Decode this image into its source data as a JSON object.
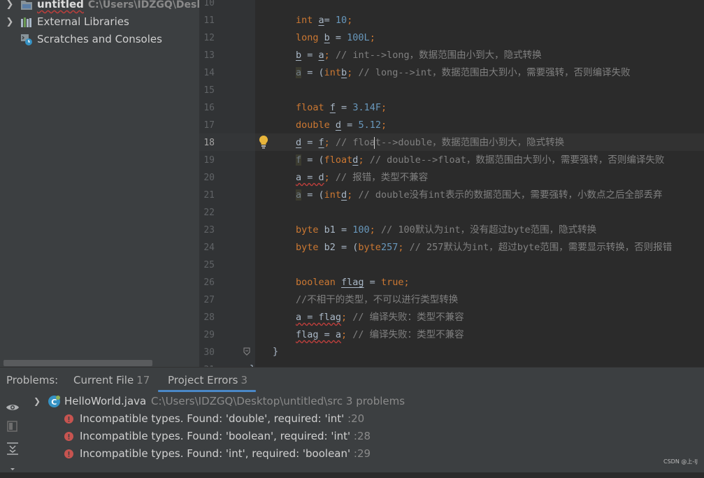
{
  "project_tree": {
    "items": [
      {
        "label": "untitled",
        "path": "C:\\Users\\IDZGQ\\Desktop\\untitled",
        "icon": "module-folder-icon"
      },
      {
        "label": "External Libraries",
        "icon": "library-icon"
      },
      {
        "label": "Scratches and Consoles",
        "icon": "scratches-icon"
      }
    ]
  },
  "editor": {
    "current_line": 18,
    "line_numbers": [
      "10",
      "11",
      "12",
      "13",
      "14",
      "15",
      "16",
      "17",
      "18",
      "19",
      "20",
      "21",
      "22",
      "23",
      "24",
      "25",
      "26",
      "27",
      "28",
      "29",
      "30",
      "31"
    ],
    "lines": [
      {
        "n": 11,
        "parts": [
          [
            "kw",
            "int "
          ],
          [
            "ul",
            "a"
          ],
          [
            "",
            "="
          ],
          [
            "num",
            " 10"
          ],
          [
            "kw",
            ";"
          ]
        ]
      },
      {
        "n": 12,
        "parts": [
          [
            "kw",
            "long "
          ],
          [
            "ul",
            "b"
          ],
          [
            "",
            " = "
          ],
          [
            "num",
            "100L"
          ],
          [
            "kw",
            ";"
          ]
        ]
      },
      {
        "n": 13,
        "parts": [
          [
            "ul",
            "b"
          ],
          [
            "",
            " = "
          ],
          [
            "ul",
            "a"
          ],
          [
            "kw",
            ";"
          ],
          [
            "cm",
            " // int-->long，数据范围由小到大，隐式转换"
          ]
        ]
      },
      {
        "n": 14,
        "parts": [
          [
            "warn",
            "a"
          ],
          [
            "",
            " = ("
          ],
          [
            "kw",
            "int"
          ],
          [
            ")"
          ],
          [
            "ul",
            "b"
          ],
          [
            "kw",
            ";"
          ],
          [
            "cm",
            " // long-->int，数据范围由大到小，需要强转，否则编译失败"
          ]
        ]
      },
      {
        "n": 15,
        "parts": []
      },
      {
        "n": 16,
        "parts": [
          [
            "kw",
            "float "
          ],
          [
            "ul",
            "f"
          ],
          [
            "",
            " = "
          ],
          [
            "num",
            "3.14F"
          ],
          [
            "kw",
            ";"
          ]
        ]
      },
      {
        "n": 17,
        "parts": [
          [
            "kw",
            "double "
          ],
          [
            "ul",
            "d"
          ],
          [
            "",
            " = "
          ],
          [
            "num",
            "5.12"
          ],
          [
            "kw",
            ";"
          ]
        ]
      },
      {
        "n": 18,
        "parts": [
          [
            "ul",
            "d"
          ],
          [
            "",
            " = "
          ],
          [
            "ul",
            "f"
          ],
          [
            "kw",
            ";"
          ],
          [
            "cm",
            " // float-->double，数据范围由小到大，隐式转换"
          ]
        ]
      },
      {
        "n": 19,
        "parts": [
          [
            "warn",
            "f"
          ],
          [
            "",
            " = ("
          ],
          [
            "kw",
            "float"
          ],
          [
            ")"
          ],
          [
            "ul",
            "d"
          ],
          [
            "kw",
            ";"
          ],
          [
            "cm",
            " // double-->float，数据范围由大到小，需要强转，否则编译失败"
          ]
        ]
      },
      {
        "n": 20,
        "parts": [
          [
            "err",
            "a = d"
          ],
          [
            "kw",
            ";"
          ],
          [
            "cm",
            " // 报错，类型不兼容"
          ]
        ]
      },
      {
        "n": 21,
        "parts": [
          [
            "warn",
            "a"
          ],
          [
            "",
            " = ("
          ],
          [
            "kw",
            "int"
          ],
          [
            ")"
          ],
          [
            "ul",
            "d"
          ],
          [
            "kw",
            ";"
          ],
          [
            "cm",
            " // double没有int表示的数据范围大，需要强转，小数点之后全部丢弃"
          ]
        ]
      },
      {
        "n": 22,
        "parts": []
      },
      {
        "n": 23,
        "parts": [
          [
            "kw",
            "byte "
          ],
          [
            "",
            "b1 = "
          ],
          [
            "num",
            "100"
          ],
          [
            "kw",
            ";"
          ],
          [
            "cm",
            " // 100默认为int，没有超过byte范围，隐式转换"
          ]
        ]
      },
      {
        "n": 24,
        "parts": [
          [
            "kw",
            "byte "
          ],
          [
            "",
            "b2 = ("
          ],
          [
            "kw",
            "byte"
          ],
          [
            ")"
          ],
          [
            "num",
            "257"
          ],
          [
            "kw",
            ";"
          ],
          [
            "cm",
            " // 257默认为int，超过byte范围，需要显示转换，否则报错"
          ]
        ]
      },
      {
        "n": 25,
        "parts": []
      },
      {
        "n": 26,
        "parts": [
          [
            "kw",
            "boolean "
          ],
          [
            "ul",
            "flag"
          ],
          [
            "",
            " = "
          ],
          [
            "kw",
            "true;"
          ]
        ]
      },
      {
        "n": 27,
        "parts": [
          [
            "cm",
            "//不相干的类型，不可以进行类型转换"
          ]
        ]
      },
      {
        "n": 28,
        "parts": [
          [
            "err",
            "a = flag"
          ],
          [
            "kw",
            ";"
          ],
          [
            "cm",
            " // 编译失败：类型不兼容"
          ]
        ]
      },
      {
        "n": 29,
        "parts": [
          [
            "err",
            "flag = a"
          ],
          [
            "kw",
            ";"
          ],
          [
            "cm",
            " // 编译失败：类型不兼容"
          ]
        ]
      },
      {
        "n": 30,
        "parts": []
      }
    ],
    "closing_brace": "}",
    "partial_bottom_brace": "}"
  },
  "problems_panel": {
    "tabs": [
      {
        "label": "Problems:",
        "count": ""
      },
      {
        "label": "Current File",
        "count": "17"
      },
      {
        "label": "Project Errors",
        "count": "3"
      }
    ],
    "file": {
      "name": "HelloWorld.java",
      "path": "C:\\Users\\IDZGQ\\Desktop\\untitled\\src",
      "summary": "3 problems"
    },
    "errors": [
      {
        "message": "Incompatible types. Found: 'double', required: 'int'",
        "line": ":20"
      },
      {
        "message": "Incompatible types. Found: 'boolean', required: 'int'",
        "line": ":28"
      },
      {
        "message": "Incompatible types. Found: 'int', required: 'boolean'",
        "line": ":29"
      }
    ]
  },
  "watermark": "CSDN @上-IJ",
  "colors": {
    "keyword": "#cc7832",
    "number": "#6897bb",
    "comment": "#808080",
    "text": "#a9b7c6",
    "error": "#bc3f3c",
    "accent": "#4a88c7"
  }
}
